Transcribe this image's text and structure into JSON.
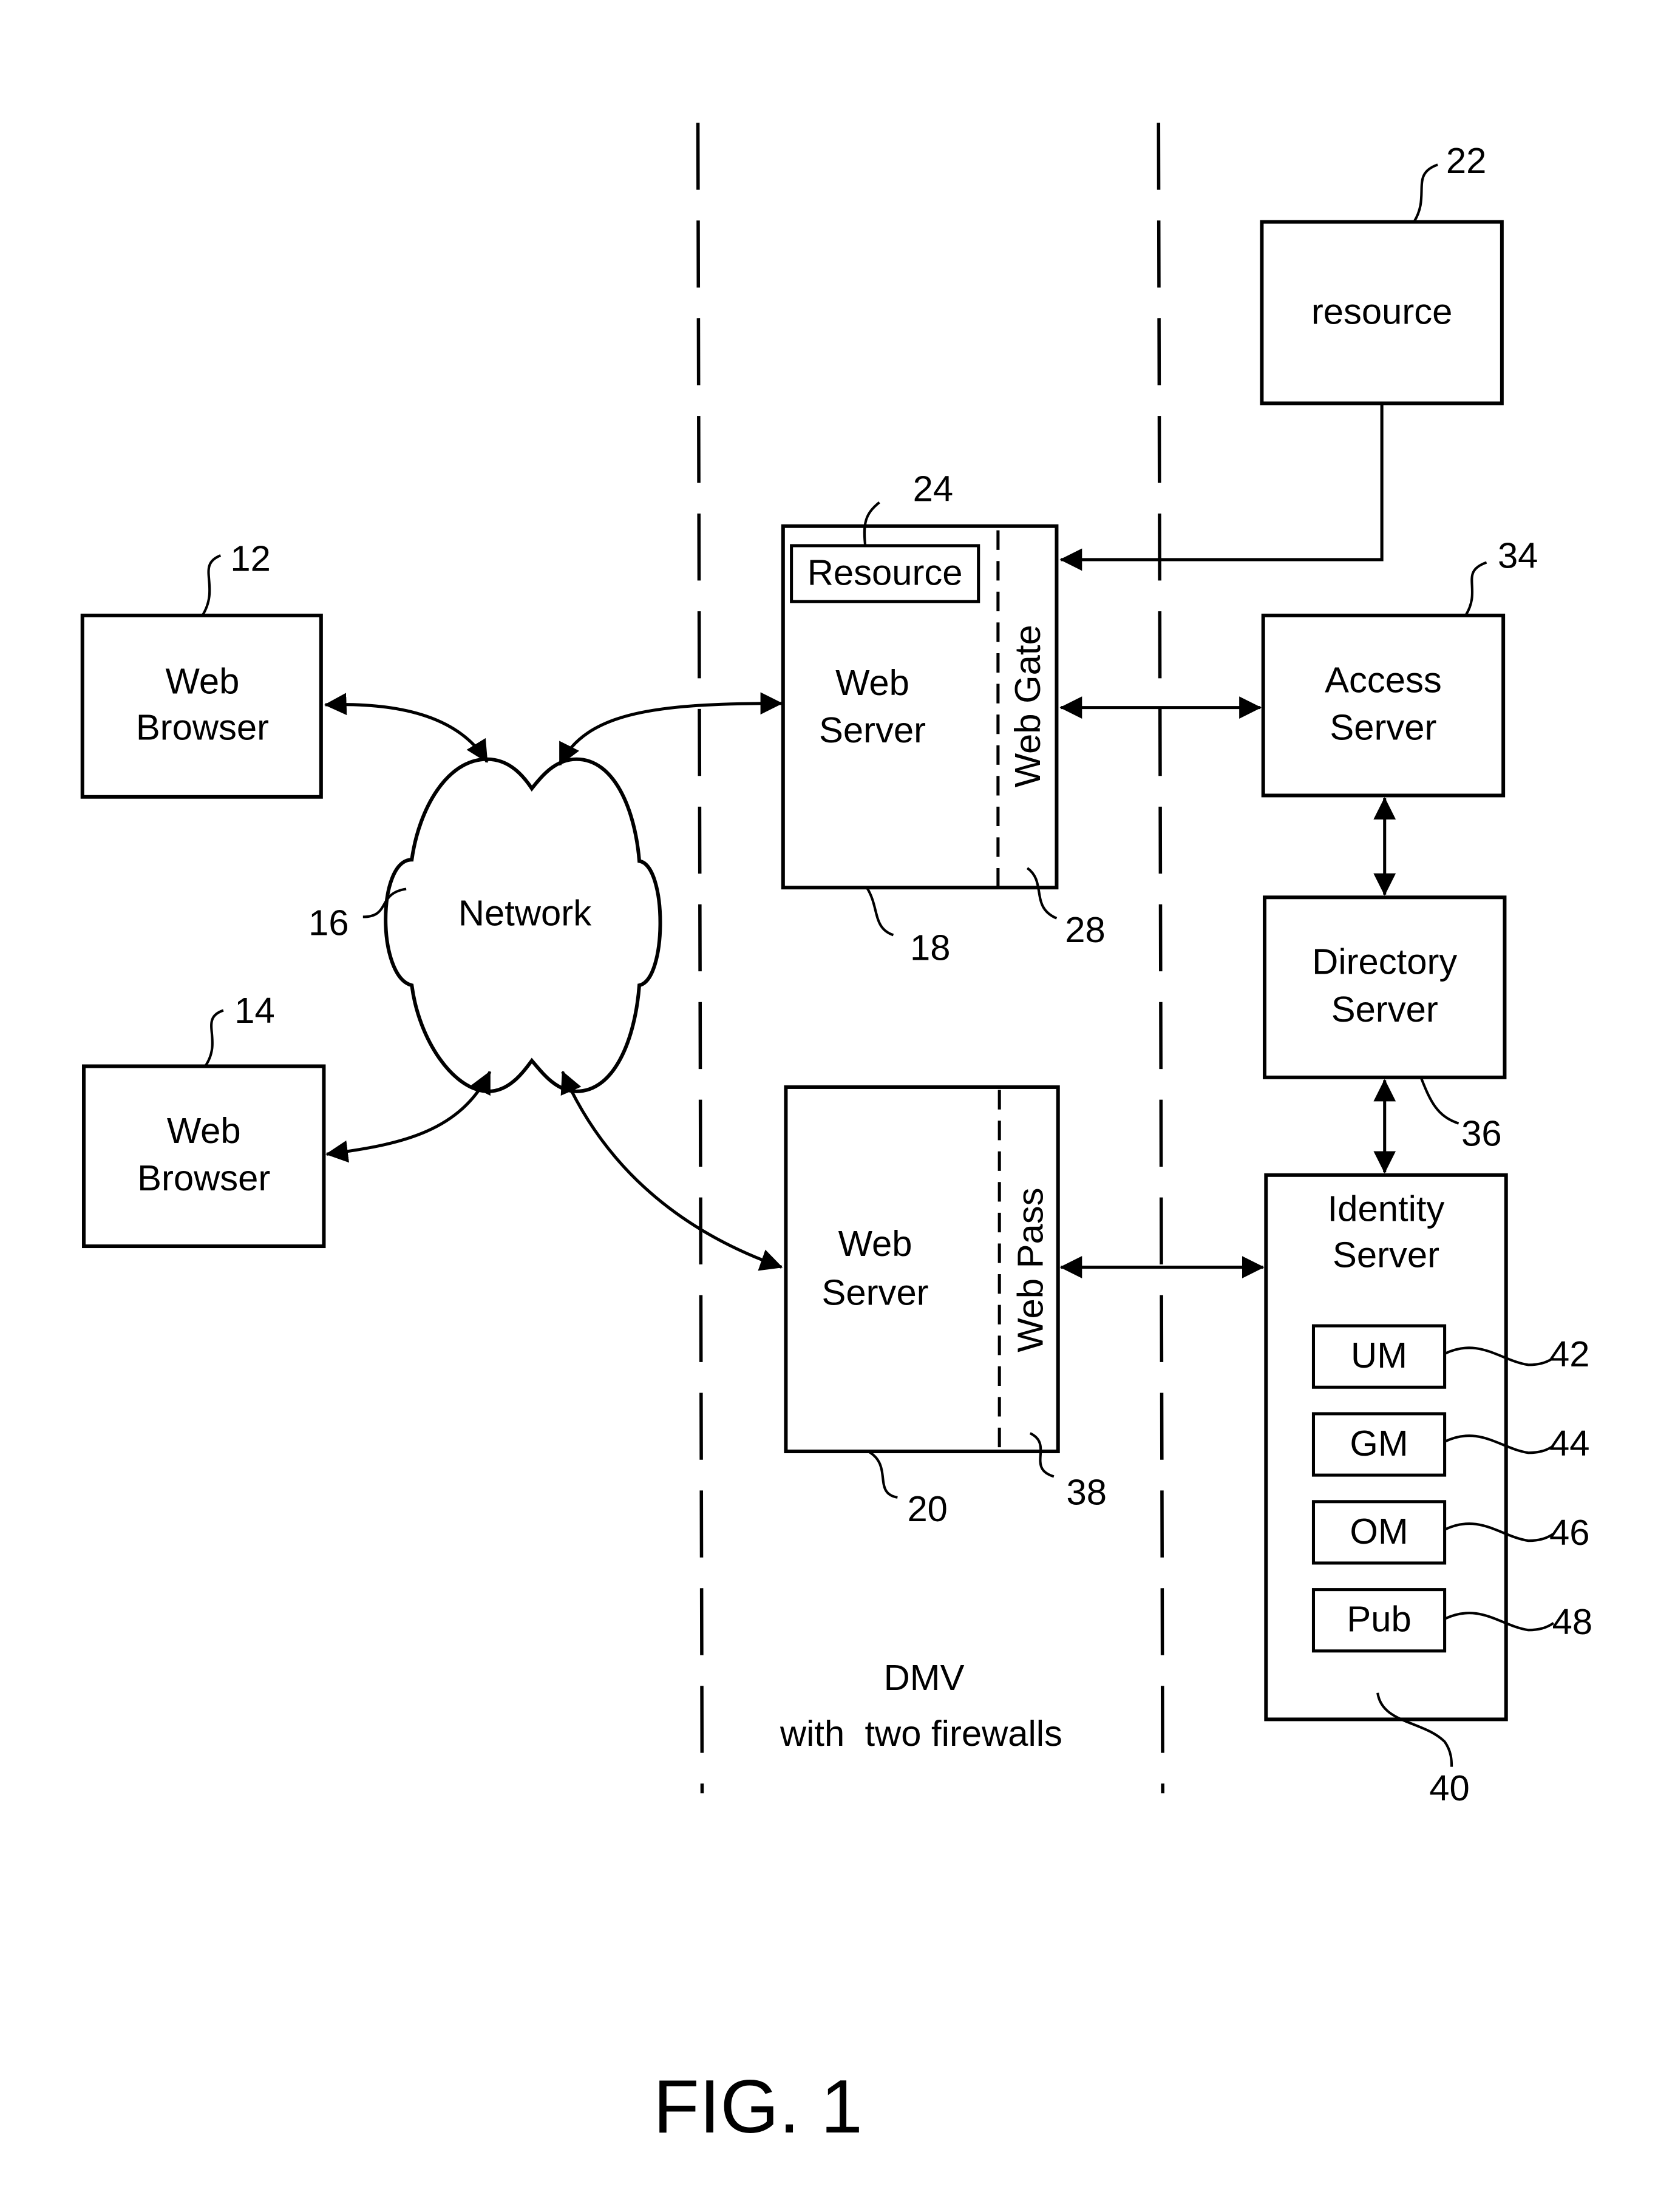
{
  "figure": {
    "title": "FIG. 1",
    "zone_label_line1": "DMV",
    "zone_label_line2": "with  two firewalls"
  },
  "nodes": {
    "browser_1": {
      "line1": "Web",
      "line2": "Browser",
      "ref": "12"
    },
    "browser_2": {
      "line1": "Web",
      "line2": "Browser",
      "ref": "14"
    },
    "network": {
      "label": "Network",
      "ref": "16"
    },
    "web_server_1": {
      "line1": "Web",
      "line2": "Server",
      "ref": "18"
    },
    "resource_inner": {
      "label": "Resource",
      "ref": "24"
    },
    "web_gate": {
      "label": "Web Gate",
      "ref": "28"
    },
    "web_server_2": {
      "line1": "Web",
      "line2": "Server",
      "ref": "20"
    },
    "web_pass": {
      "label": "Web Pass",
      "ref": "38"
    },
    "resource": {
      "label": "resource",
      "ref": "22"
    },
    "access_server": {
      "line1": "Access",
      "line2": "Server",
      "ref": "34"
    },
    "directory_server": {
      "line1": "Directory",
      "line2": "Server",
      "ref": "36"
    },
    "identity_server": {
      "line1": "Identity",
      "line2": "Server",
      "ref": "40",
      "modules": [
        {
          "label": "UM",
          "ref": "42"
        },
        {
          "label": "GM",
          "ref": "44"
        },
        {
          "label": "OM",
          "ref": "46"
        },
        {
          "label": "Pub",
          "ref": "48"
        }
      ]
    }
  }
}
